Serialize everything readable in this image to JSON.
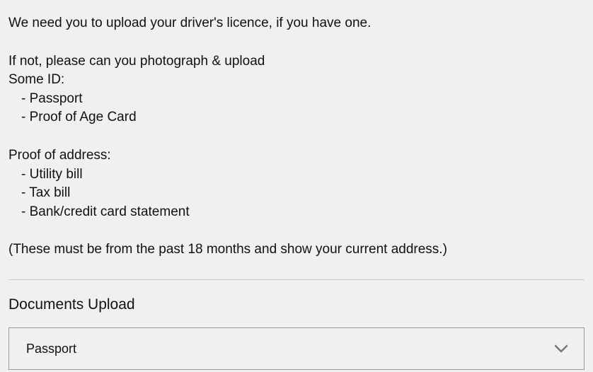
{
  "instructions": {
    "line1": "We need you to upload your driver's licence, if you have one.",
    "line2": "If not, please can you photograph & upload",
    "some_id_label": "Some ID:",
    "id_items": [
      "- Passport",
      "- Proof of Age Card"
    ],
    "proof_address_label": "Proof of address:",
    "address_items": [
      "- Utility bill",
      "- Tax bill",
      "- Bank/credit card statement"
    ],
    "note": "(These must be from the past 18 months and show your current address.)"
  },
  "upload": {
    "section_title": "Documents Upload",
    "selected": "Passport"
  }
}
